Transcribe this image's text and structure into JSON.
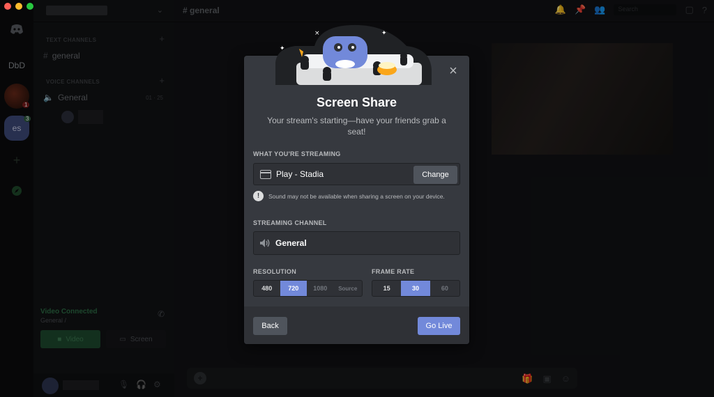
{
  "window": {
    "traffic_colors": [
      "#ff5f57",
      "#febc2e",
      "#28c840"
    ]
  },
  "servers": [
    {
      "name": "discord-home-icon"
    },
    {
      "label": "DbD"
    },
    {
      "label": "",
      "badge": "1"
    },
    {
      "label": "es",
      "badge": "3"
    },
    {
      "name": "add-server-icon"
    },
    {
      "name": "explore-icon"
    }
  ],
  "sidebar": {
    "text_category": "TEXT CHANNELS",
    "text_channel": "general",
    "voice_category": "VOICE CHANNELS",
    "voice_channel": "General",
    "voice_counts": "01 · 25",
    "voice_connected": "Video Connected",
    "voice_sub": "General /",
    "video_button": "Video",
    "screen_button": "Screen"
  },
  "topbar": {
    "channel": "general",
    "search_placeholder": "Search"
  },
  "modal": {
    "title": "Screen Share",
    "subtitle": "Your stream's starting—have your friends grab a seat!",
    "streaming_label": "WHAT YOU'RE STREAMING",
    "source_name": "Play - Stadia",
    "change_button": "Change",
    "warning": "Sound may not be available when sharing a screen on your device.",
    "channel_label": "STREAMING CHANNEL",
    "channel_name": "General",
    "resolution_label": "RESOLUTION",
    "resolution_options": [
      "480",
      "720",
      "1080",
      "Source"
    ],
    "resolution_selected": "720",
    "framerate_label": "FRAME RATE",
    "framerate_options": [
      "15",
      "30",
      "60"
    ],
    "framerate_selected": "30",
    "back_button": "Back",
    "golive_button": "Go Live",
    "close_label": "×"
  },
  "colors": {
    "accent": "#7289da",
    "modal_bg": "#36393f",
    "input_bg": "#2f3136",
    "button_grey": "#4f545c"
  }
}
